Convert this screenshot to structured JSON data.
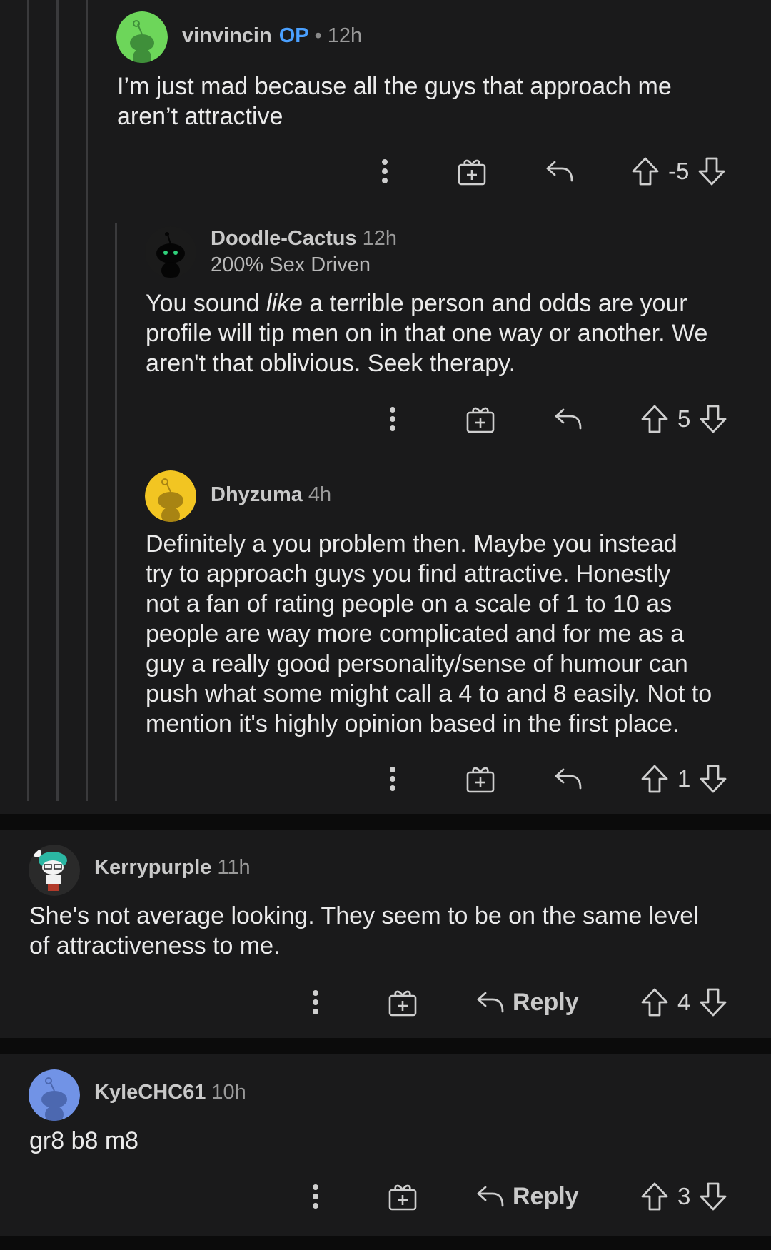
{
  "comments": [
    {
      "username": "vinvincin",
      "op_label": "OP",
      "separator": "•",
      "time": "12h",
      "avatar_color": "#6dd65a",
      "body_lines": [
        "I’m just mad because all the guys that approach me",
        "aren’t attractive"
      ],
      "score": "-5"
    },
    {
      "username": "Doodle-Cactus",
      "time": "12h",
      "flair": "200% Sex Driven",
      "avatar_color": "#0d0d0d",
      "body_pre": "You sound ",
      "body_em": "like",
      "body_post": " a terrible person and odds are your",
      "body_lines": [
        "profile will tip men on in that one way or another. We",
        "aren't that oblivious. Seek therapy."
      ],
      "score": "5"
    },
    {
      "username": "Dhyzuma",
      "time": "4h",
      "avatar_color": "#f2c522",
      "body_lines": [
        "Definitely a you problem then. Maybe you instead",
        "try to approach guys you find attractive. Honestly",
        "not a fan of rating people on a scale of 1 to 10 as",
        "people are way more complicated and for me as a",
        "guy a really good personality/sense of humour can",
        "push what some might call a 4 to and 8 easily. Not to",
        "mention it's highly opinion based in the first place."
      ],
      "score": "1"
    },
    {
      "username": "Kerrypurple",
      "time": "11h",
      "avatar_color": "#2a2a2a",
      "body_lines": [
        "She's not average looking. They seem to be on the same level",
        "of attractiveness to me."
      ],
      "reply_label": "Reply",
      "score": "4"
    },
    {
      "username": "KyleCHC61",
      "time": "10h",
      "avatar_color": "#7193e6",
      "body_lines": [
        "gr8 b8 m8"
      ],
      "reply_label": "Reply",
      "score": "3"
    }
  ],
  "icons": {
    "more": "more-options-icon",
    "award": "award-icon",
    "reply": "reply-icon",
    "upvote": "upvote-icon",
    "downvote": "downvote-icon"
  },
  "colors": {
    "background": "#1a1a1b",
    "text": "#eaeaea",
    "op_blue": "#4aa0ff"
  }
}
